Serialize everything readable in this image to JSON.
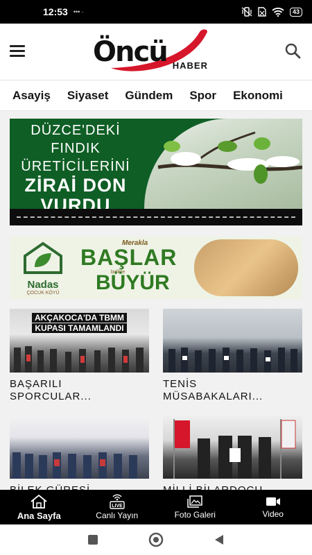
{
  "status_bar": {
    "time": "12:53",
    "left_icons": "••• ·",
    "battery": "43"
  },
  "header": {
    "logo_text": "Öncü",
    "logo_sub": "HABER"
  },
  "categories": [
    "Asayiş",
    "Siyaset",
    "Gündem",
    "Spor",
    "Ekonomi"
  ],
  "banner1": {
    "lines": [
      "DÜZCE'DEKİ",
      "FINDIK",
      "ÜRETİCİLERİNİ",
      "ZİRAİ DON",
      "VURDU"
    ]
  },
  "banner2": {
    "brand": "Nadas",
    "brand_sub": "ÇOCUK KÖYÜ",
    "meraka": "Merakla",
    "baslar": "BAŞLAR",
    "birlikte": "birlikte",
    "buyur": "BÜYÜR"
  },
  "news": [
    {
      "image_caption": [
        "AKÇAKOCA'DA TBMM",
        "KUPASI TAMAMLANDI"
      ],
      "title_lines": [
        "BAŞARILI",
        "SPORCULAR..."
      ]
    },
    {
      "image_caption": [],
      "title_lines": [
        "TENİS",
        "MÜSABAKALARI..."
      ]
    },
    {
      "image_caption": [],
      "title_lines": [
        "BİLEK GÜREŞİ",
        ""
      ]
    },
    {
      "image_caption": [],
      "title_lines": [
        "MİLLİ BİLARDOCU",
        ""
      ]
    }
  ],
  "bottom_nav": [
    {
      "label": "Ana Sayfa",
      "icon": "home-icon",
      "active": true
    },
    {
      "label": "Canlı Yayın",
      "icon": "live-icon",
      "active": false
    },
    {
      "label": "Foto Galeri",
      "icon": "gallery-icon",
      "active": false
    },
    {
      "label": "Video",
      "icon": "video-icon",
      "active": false
    }
  ],
  "colors": {
    "brand_red": "#d6162a",
    "nav_bg": "#000000",
    "banner_green": "#0f5e25"
  }
}
